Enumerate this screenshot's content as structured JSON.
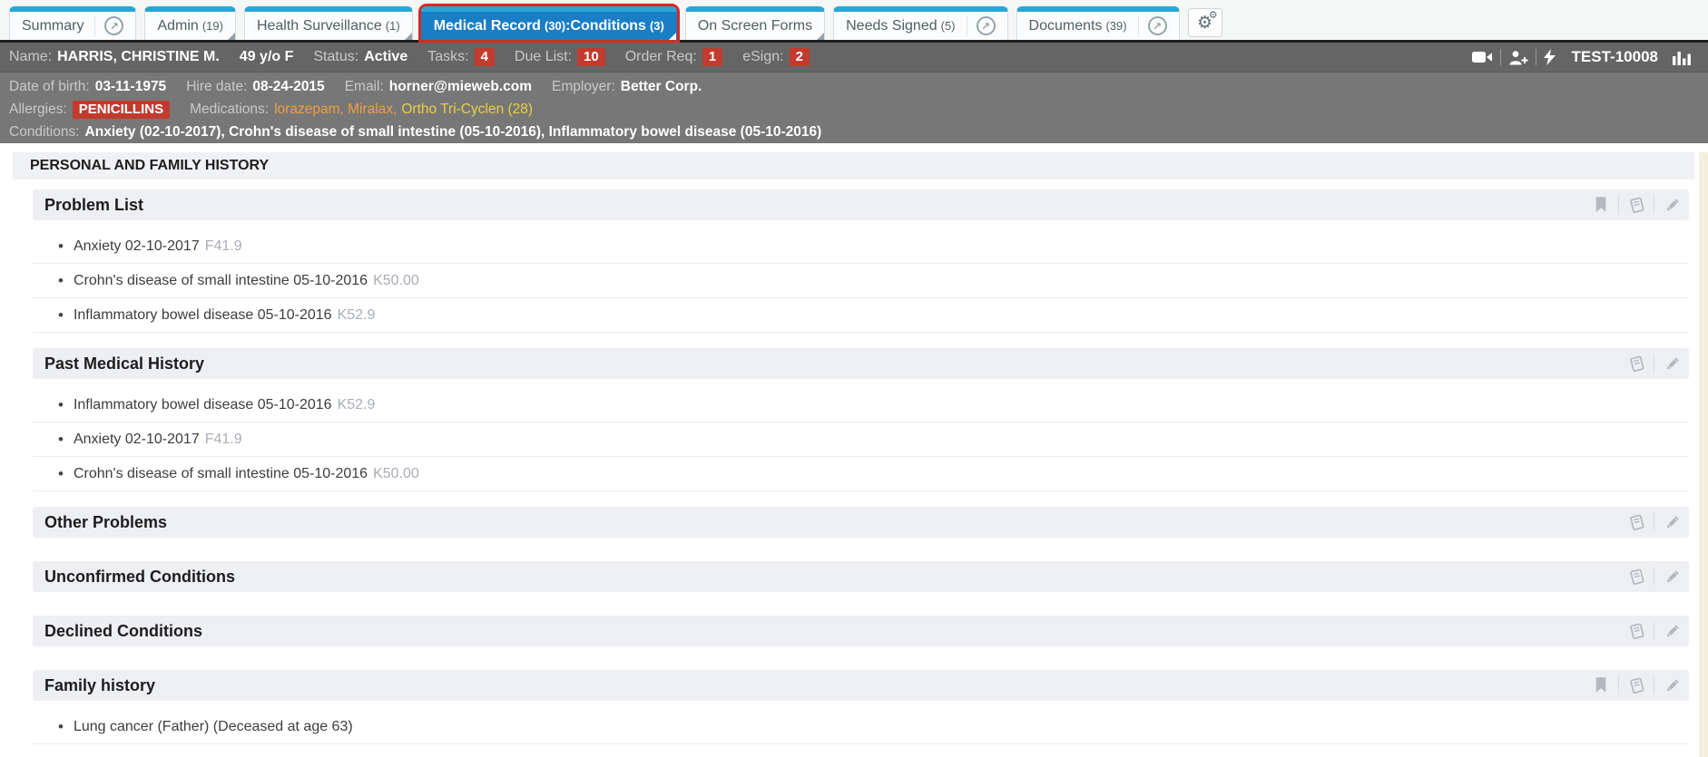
{
  "icons": {
    "external_link": "↗",
    "settings_gear": "⚙",
    "bullet": "•"
  },
  "tabs": {
    "summary": {
      "label": "Summary"
    },
    "admin": {
      "label": "Admin",
      "count": "(19)"
    },
    "health_surveillance": {
      "label": "Health Surveillance",
      "count": "(1)"
    },
    "medical_record": {
      "label": "Medical Record",
      "count": "(30)",
      "sub_label": ":Conditions",
      "sub_count": "(3)"
    },
    "on_screen_forms": {
      "label": "On Screen Forms"
    },
    "needs_signed": {
      "label": "Needs Signed",
      "count": "(5)"
    },
    "documents": {
      "label": "Documents",
      "count": "(39)"
    }
  },
  "patient_bar": {
    "name_label": "Name:",
    "name": "HARRIS, CHRISTINE M.",
    "age_sex": "49 y/o F",
    "status_label": "Status:",
    "status": "Active",
    "tasks_label": "Tasks:",
    "tasks_count": "4",
    "due_list_label": "Due List:",
    "due_list_count": "10",
    "order_req_label": "Order Req:",
    "order_req_count": "1",
    "esign_label": "eSign:",
    "esign_count": "2",
    "chart_id": "TEST-10008"
  },
  "demographics": {
    "dob_label": "Date of birth:",
    "dob": "03-11-1975",
    "hire_date_label": "Hire date:",
    "hire_date": "08-24-2015",
    "email_label": "Email:",
    "email": "horner@mieweb.com",
    "employer_label": "Employer:",
    "employer": "Better Corp."
  },
  "allergies": {
    "label": "Allergies:",
    "badge": "PENICILLINS"
  },
  "medications": {
    "label": "Medications:",
    "items_orange": "lorazepam, Miralax,",
    "items_yellow": "Ortho Tri-Cyclen (28)"
  },
  "conditions": {
    "label": "Conditions:",
    "value": "Anxiety (02-10-2017), Crohn's disease of small intestine (05-10-2016), Inflammatory bowel disease (05-10-2016)"
  },
  "page_title": "PERSONAL AND FAMILY HISTORY",
  "sections": [
    {
      "title": "Problem List",
      "items": [
        {
          "text": "Anxiety 02-10-2017",
          "code": "F41.9"
        },
        {
          "text": "Crohn's disease of small intestine 05-10-2016",
          "code": "K50.00"
        },
        {
          "text": "Inflammatory bowel disease 05-10-2016",
          "code": "K52.9"
        }
      ]
    },
    {
      "title": "Past Medical History",
      "items": [
        {
          "text": "Inflammatory bowel disease 05-10-2016",
          "code": "K52.9"
        },
        {
          "text": "Anxiety 02-10-2017",
          "code": "F41.9"
        },
        {
          "text": "Crohn's disease of small intestine 05-10-2016",
          "code": "K50.00"
        }
      ]
    },
    {
      "title": "Other Problems",
      "items": []
    },
    {
      "title": "Unconfirmed Conditions",
      "items": []
    },
    {
      "title": "Declined Conditions",
      "items": []
    },
    {
      "title": "Family history",
      "items": [
        {
          "text": "Lung cancer (Father) (Deceased at age 63)",
          "code": ""
        }
      ]
    }
  ],
  "colors": {
    "tab_blue_cap": "#2aa5d6",
    "active_tab_bg": "#1a7ec5",
    "active_outline_red": "#d42a24",
    "header_gray_dark": "#656565",
    "header_gray": "#777777",
    "badge_red": "#c23b2e",
    "med_orange": "#f0a040",
    "med_yellow": "#e8d040",
    "band_gray": "#edeff3",
    "code_gray": "#a9aeb6",
    "scroll_strip_cream": "#f4efdd"
  }
}
